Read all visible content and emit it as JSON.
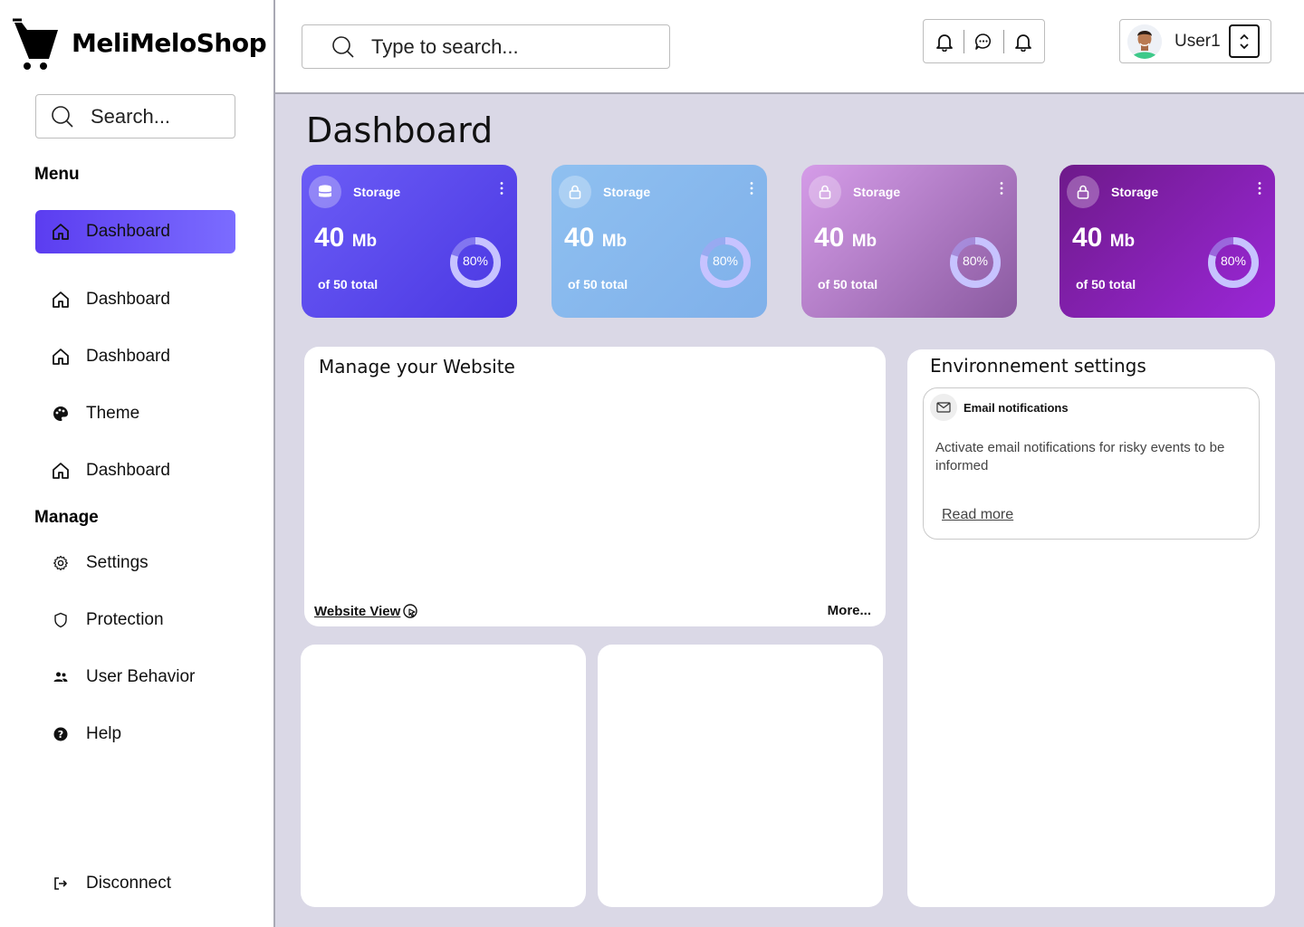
{
  "brand": {
    "name": "MeliMeloShop"
  },
  "sidebar": {
    "search_placeholder": "Search...",
    "menu_title": "Menu",
    "menu_items": [
      {
        "label": "Dashboard",
        "icon": "home-icon",
        "active": true
      },
      {
        "label": "Dashboard",
        "icon": "home-icon",
        "active": false
      },
      {
        "label": "Dashboard",
        "icon": "home-icon",
        "active": false
      },
      {
        "label": "Theme",
        "icon": "palette-icon",
        "active": false
      },
      {
        "label": "Dashboard",
        "icon": "home-icon",
        "active": false
      }
    ],
    "manage_title": "Manage",
    "manage_items": [
      {
        "label": "Settings",
        "icon": "gear-icon"
      },
      {
        "label": "Protection",
        "icon": "shield-icon"
      },
      {
        "label": "User Behavior",
        "icon": "users-icon"
      },
      {
        "label": "Help",
        "icon": "help-icon"
      }
    ],
    "disconnect_label": "Disconnect"
  },
  "topbar": {
    "search_placeholder": "Type to search...",
    "icons": [
      "bell-icon",
      "chat-icon",
      "bell-icon"
    ],
    "user_name": "User1"
  },
  "main": {
    "title": "Dashboard",
    "cards": [
      {
        "title": "Storage",
        "value": "40",
        "unit": "Mb",
        "subtitle": "of 50 total",
        "percent_label": "80%",
        "percent": 0.8,
        "icon": "database-icon",
        "gradient": [
          "#6b5cf6",
          "#4a37e2"
        ]
      },
      {
        "title": "Storage",
        "value": "40",
        "unit": "Mb",
        "subtitle": "of 50 total",
        "percent_label": "80%",
        "percent": 0.8,
        "icon": "lock-icon",
        "gradient": [
          "#8fc0f0",
          "#7fb0ea"
        ]
      },
      {
        "title": "Storage",
        "value": "40",
        "unit": "Mb",
        "subtitle": "of 50 total",
        "percent_label": "80%",
        "percent": 0.8,
        "icon": "lock-icon",
        "gradient": [
          "#d59ce8",
          "#8a5aa0"
        ]
      },
      {
        "title": "Storage",
        "value": "40",
        "unit": "Mb",
        "subtitle": "of 50 total",
        "percent_label": "80%",
        "percent": 0.8,
        "icon": "lock-icon",
        "gradient": [
          "#6e1a8a",
          "#9b27d8"
        ]
      }
    ],
    "manage_panel": {
      "title": "Manage your Website",
      "website_view_label": "Website View",
      "more_label": "More..."
    },
    "env_panel": {
      "title": "Environnement settings",
      "notification": {
        "title": "Email notifications",
        "body": "Activate email notifications for risky events to be informed",
        "link": "Read more"
      }
    }
  },
  "colors": {
    "accent": "#5b3df0",
    "main_bg": "#dad8e6",
    "ring_track": "#a7a0f6",
    "ring_fill": "#c7c3ff"
  }
}
